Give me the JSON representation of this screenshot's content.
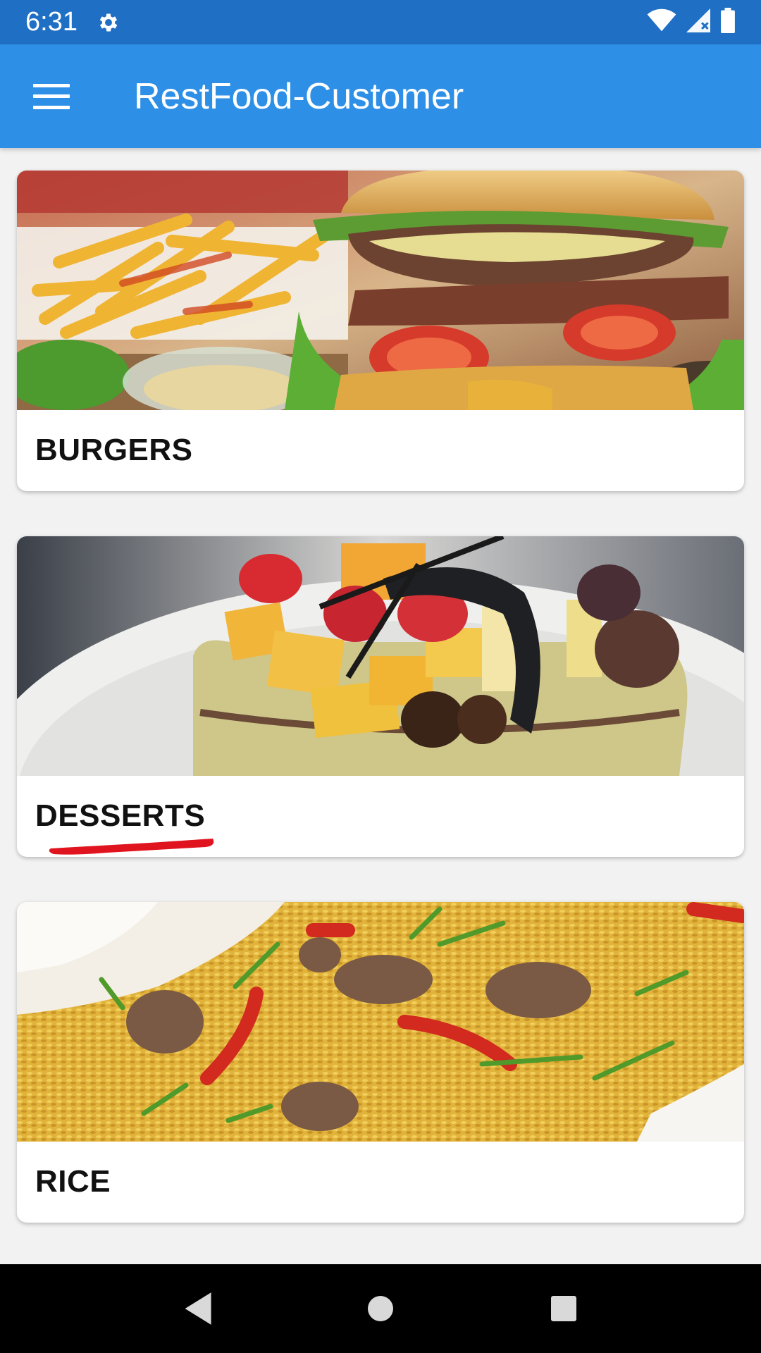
{
  "status_bar": {
    "time": "6:31",
    "icons": [
      "gear-icon",
      "wifi-icon",
      "cell-signal-icon",
      "battery-icon"
    ]
  },
  "app_bar": {
    "menu_icon": "hamburger-menu-icon",
    "title": "RestFood-Customer",
    "color": "#2d8fe6"
  },
  "categories": [
    {
      "label": "BURGERS",
      "image": "burger-and-fries-photo"
    },
    {
      "label": "DESSERTS",
      "image": "fruit-cake-dessert-photo"
    },
    {
      "label": "RICE",
      "image": "fried-rice-photo"
    }
  ],
  "nav_bar": {
    "icons": [
      "back-icon",
      "home-icon",
      "recents-icon"
    ]
  },
  "colors": {
    "status_bar": "#1f6fc4",
    "app_bar": "#2d8fe6",
    "annotation_red": "#e0141e"
  }
}
